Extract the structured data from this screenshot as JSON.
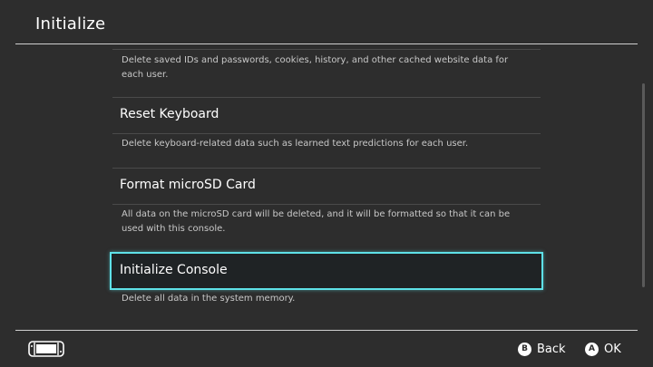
{
  "header": {
    "title": "Initialize"
  },
  "items": [
    {
      "description": "Delete saved IDs and passwords, cookies, history, and other cached website data for each user."
    },
    {
      "label": "Reset Keyboard",
      "description": "Delete keyboard-related data such as learned text predictions for each user."
    },
    {
      "label": "Format microSD Card",
      "description": "All data on the microSD card will be deleted, and it will be formatted so that it can be used with this console."
    },
    {
      "label": "Initialize Console",
      "description": "Delete all data in the system memory.",
      "selected": true
    }
  ],
  "footer": {
    "console_icon": "console-icon",
    "back": {
      "glyph": "B",
      "label": "Back"
    },
    "ok": {
      "glyph": "A",
      "label": "OK"
    }
  },
  "colors": {
    "background": "#2d2d2d",
    "selection_border": "#5ee1e8",
    "selection_fill": "#1f2325",
    "description_text": "#c8c8c8"
  }
}
